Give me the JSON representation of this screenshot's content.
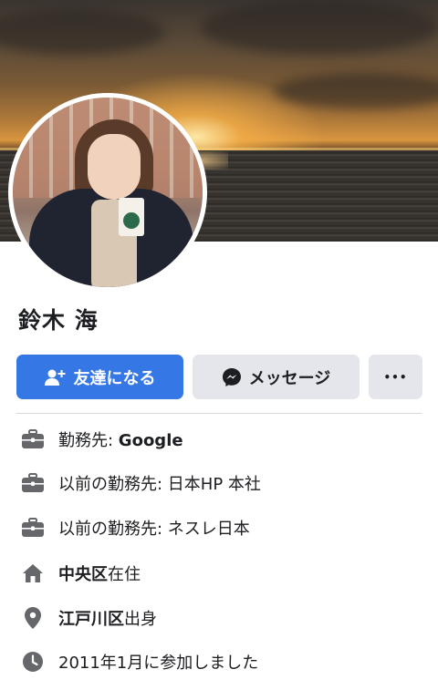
{
  "profile": {
    "name": "鈴木 海"
  },
  "actions": {
    "add_friend_label": "友達になる",
    "message_label": "メッセージ",
    "more_label": "•••"
  },
  "details": [
    {
      "icon": "briefcase-icon",
      "prefix": "勤務先: ",
      "bold": "Google",
      "suffix": ""
    },
    {
      "icon": "briefcase-icon",
      "prefix": "以前の勤務先: 日本HP 本社",
      "bold": "",
      "suffix": ""
    },
    {
      "icon": "briefcase-icon",
      "prefix": "以前の勤務先: ネスレ日本",
      "bold": "",
      "suffix": ""
    },
    {
      "icon": "home-icon",
      "prefix": "",
      "bold": "中央区",
      "suffix": "在住"
    },
    {
      "icon": "location-pin-icon",
      "prefix": "",
      "bold": "江戸川区",
      "suffix": "出身"
    },
    {
      "icon": "clock-icon",
      "prefix": "2011年1月に参加しました",
      "bold": "",
      "suffix": ""
    }
  ],
  "colors": {
    "primary_button": "#3578e5",
    "secondary_button": "#e4e6eb",
    "icon_gray": "#65676b"
  }
}
